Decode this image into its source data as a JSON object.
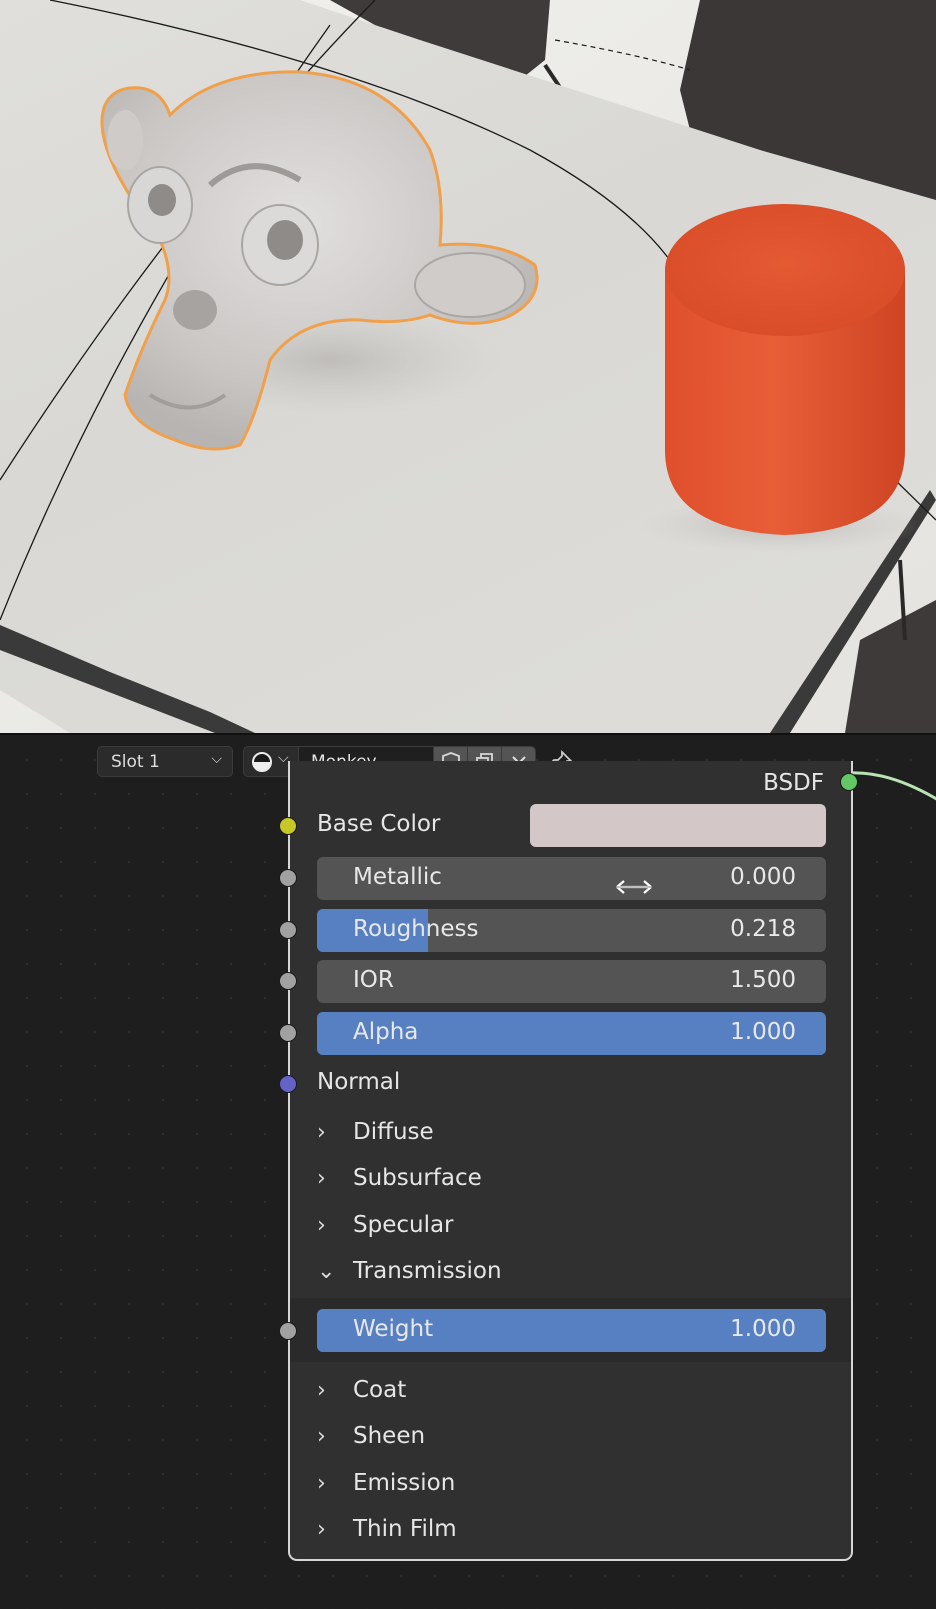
{
  "header": {
    "slot_select": "Slot 1",
    "material_name": "Monkey",
    "icons": [
      "material-ball-icon",
      "chevron-down-icon",
      "fake-user-shield-icon",
      "duplicate-material-icon",
      "unlink-close-icon",
      "pin-icon"
    ]
  },
  "node": {
    "output_label": "BSDF",
    "base_color_label": "Base Color",
    "base_color_value": "#d3c8c7",
    "sliders": {
      "metallic": {
        "label": "Metallic",
        "value": "0.000",
        "fraction": 0.0
      },
      "roughness": {
        "label": "Roughness",
        "value": "0.218",
        "fraction": 0.218
      },
      "ior": {
        "label": "IOR",
        "value": "1.500",
        "fraction": 0.0
      },
      "alpha": {
        "label": "Alpha",
        "value": "1.000",
        "fraction": 1.0
      },
      "weight": {
        "label": "Weight",
        "value": "1.000",
        "fraction": 1.0
      }
    },
    "normal_label": "Normal",
    "panels": {
      "diffuse": "Diffuse",
      "subsurface": "Subsurface",
      "specular": "Specular",
      "transmission": "Transmission",
      "coat": "Coat",
      "sheen": "Sheen",
      "emission": "Emission",
      "thin_film": "Thin Film"
    },
    "arrows": {
      "collapsed": "›",
      "expanded": "⌄"
    }
  },
  "colors": {
    "socket_color": "#c7c729",
    "socket_float": "#a1a1a1",
    "socket_vector": "#6363c7",
    "socket_shader": "#63c763",
    "slider_fill": "#5680c2",
    "slider_bg": "#545454",
    "selection_outline": "#f0a04a",
    "cylinder": "#e3542f"
  }
}
